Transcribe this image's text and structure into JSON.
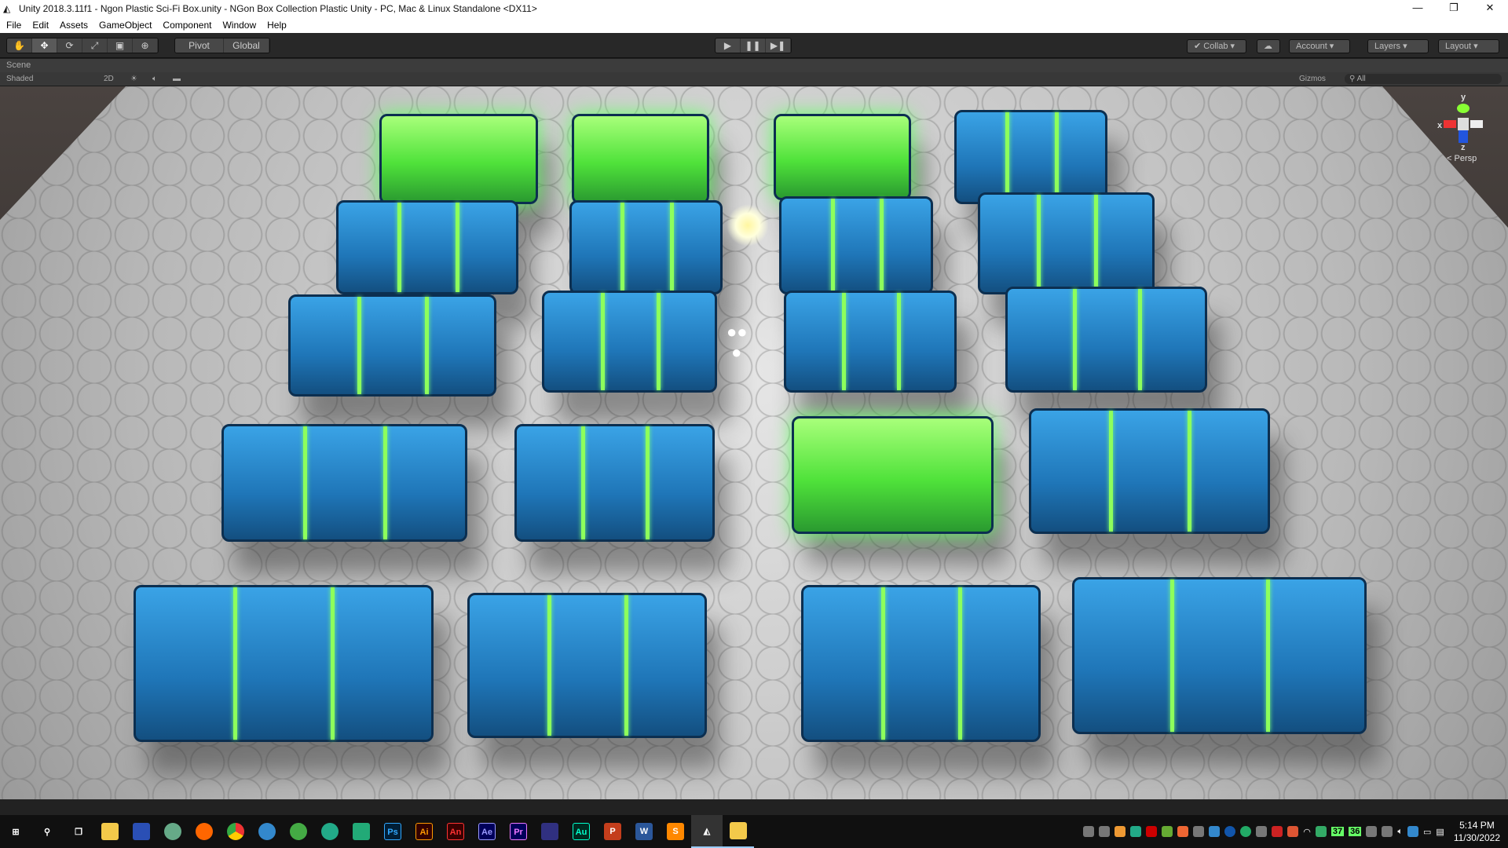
{
  "window": {
    "title": "Unity 2018.3.11f1 - Ngon Plastic Sci-Fi Box.unity - NGon Box Collection Plastic Unity - PC, Mac & Linux Standalone <DX11>",
    "minimize": "—",
    "restore": "❐",
    "close": "✕"
  },
  "menu": [
    "File",
    "Edit",
    "Assets",
    "GameObject",
    "Component",
    "Window",
    "Help"
  ],
  "toolbar": {
    "tools": [
      "✋",
      "✥",
      "⟳",
      "⤢",
      "▣",
      "⊕"
    ],
    "pivot": "Pivot",
    "global": "Global",
    "play": "▶",
    "pause": "❚❚",
    "step": "▶❚",
    "collab": "Collab",
    "cloud": "☁",
    "account": "Account",
    "layers": "Layers",
    "layout": "Layout"
  },
  "scene": {
    "tab": "Scene",
    "shading": "Shaded",
    "mode2d": "2D",
    "gizmos": "Gizmos",
    "search_placeholder": "All",
    "persp": "Persp",
    "axis_x": "x",
    "axis_y": "y",
    "axis_z": "z"
  },
  "taskbar": {
    "apps": [
      "Ps",
      "Ai",
      "An",
      "Ae",
      "Pr",
      "Au"
    ],
    "tray_temps": [
      "37",
      "36"
    ],
    "time": "5:14 PM",
    "date": "11/30/2022"
  },
  "colors": {
    "accent_green": "#8dff5c",
    "box_blue": "#1f76b8"
  }
}
